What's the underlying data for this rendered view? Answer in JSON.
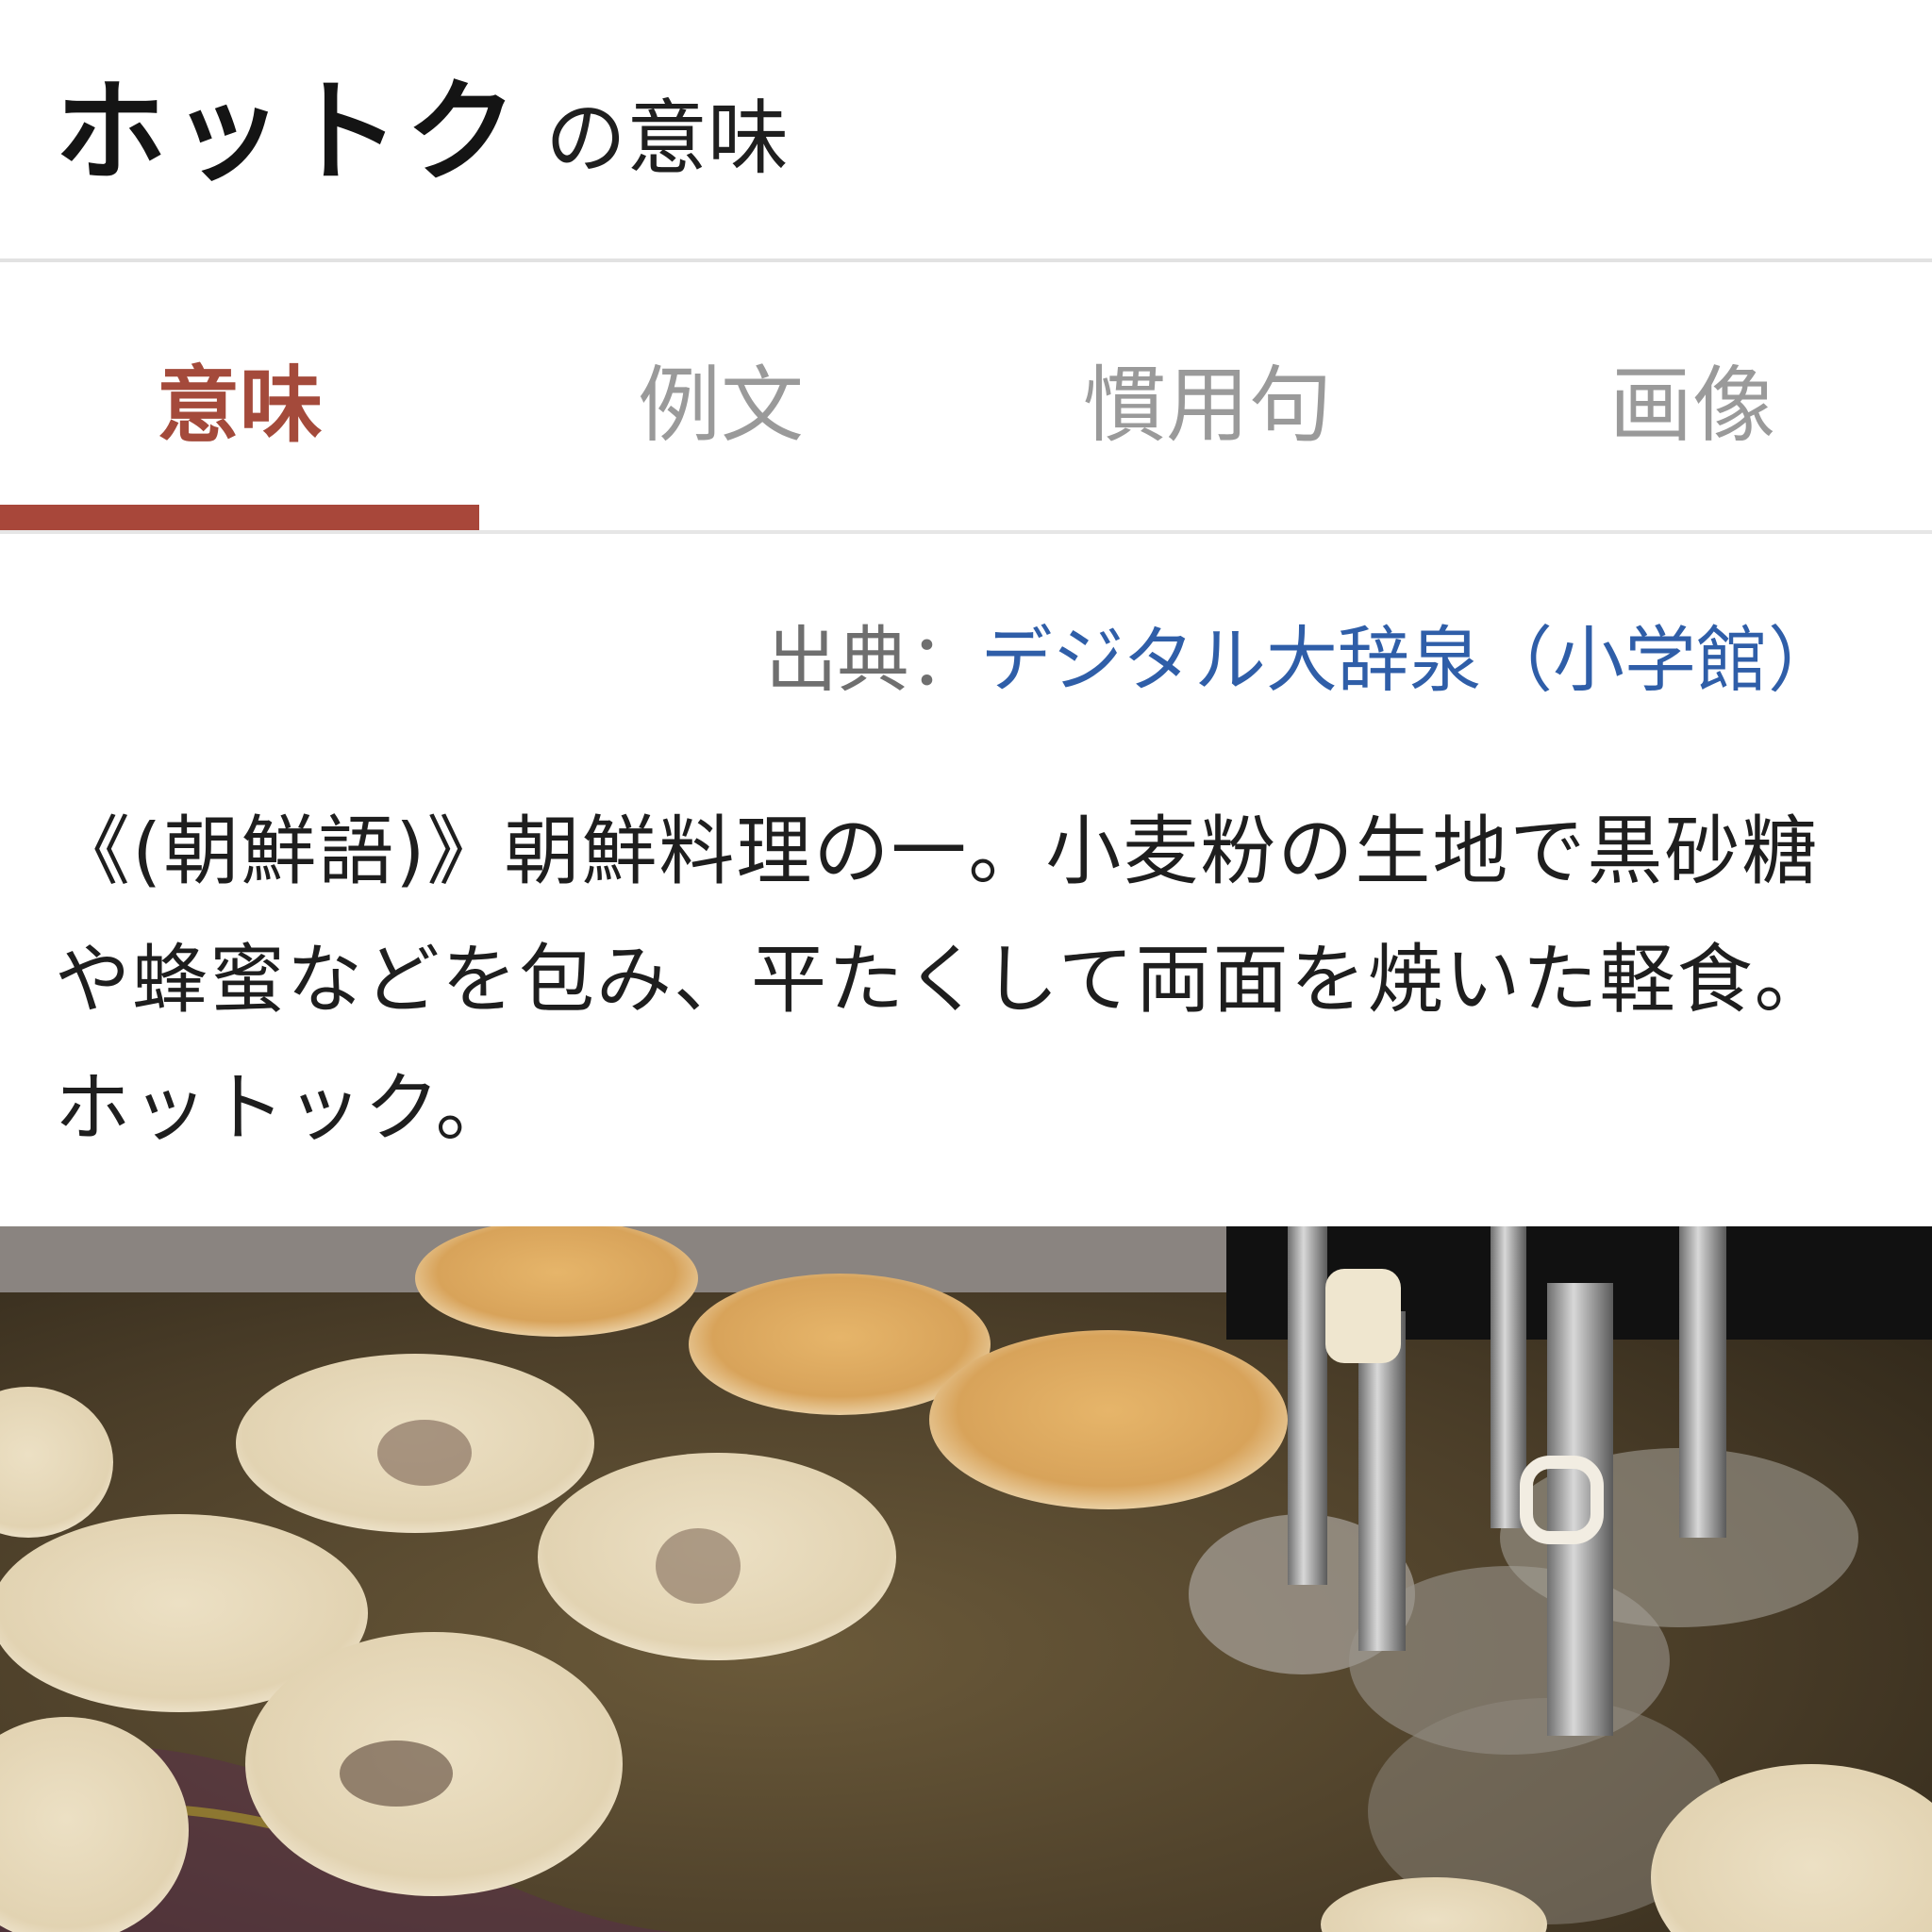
{
  "header": {
    "word": "ホットク",
    "suffix": "の意味"
  },
  "tabs": [
    {
      "label": "意味",
      "active": true
    },
    {
      "label": "例文",
      "active": false
    },
    {
      "label": "慣用句",
      "active": false
    },
    {
      "label": "画像",
      "active": false
    }
  ],
  "source": {
    "label": "出典：",
    "link_text": "デジタル大辞泉（小学館）"
  },
  "definition": {
    "text": "《(朝鮮語)》朝鮮料理の一。小麦粉の生地で黒砂糖や蜂蜜などを包み、平たくして両面を焼いた軽食。ホットック。"
  },
  "colors": {
    "accent": "#a8473a",
    "link": "#2f5ea8",
    "inactive_tab": "#9a9a9a"
  }
}
